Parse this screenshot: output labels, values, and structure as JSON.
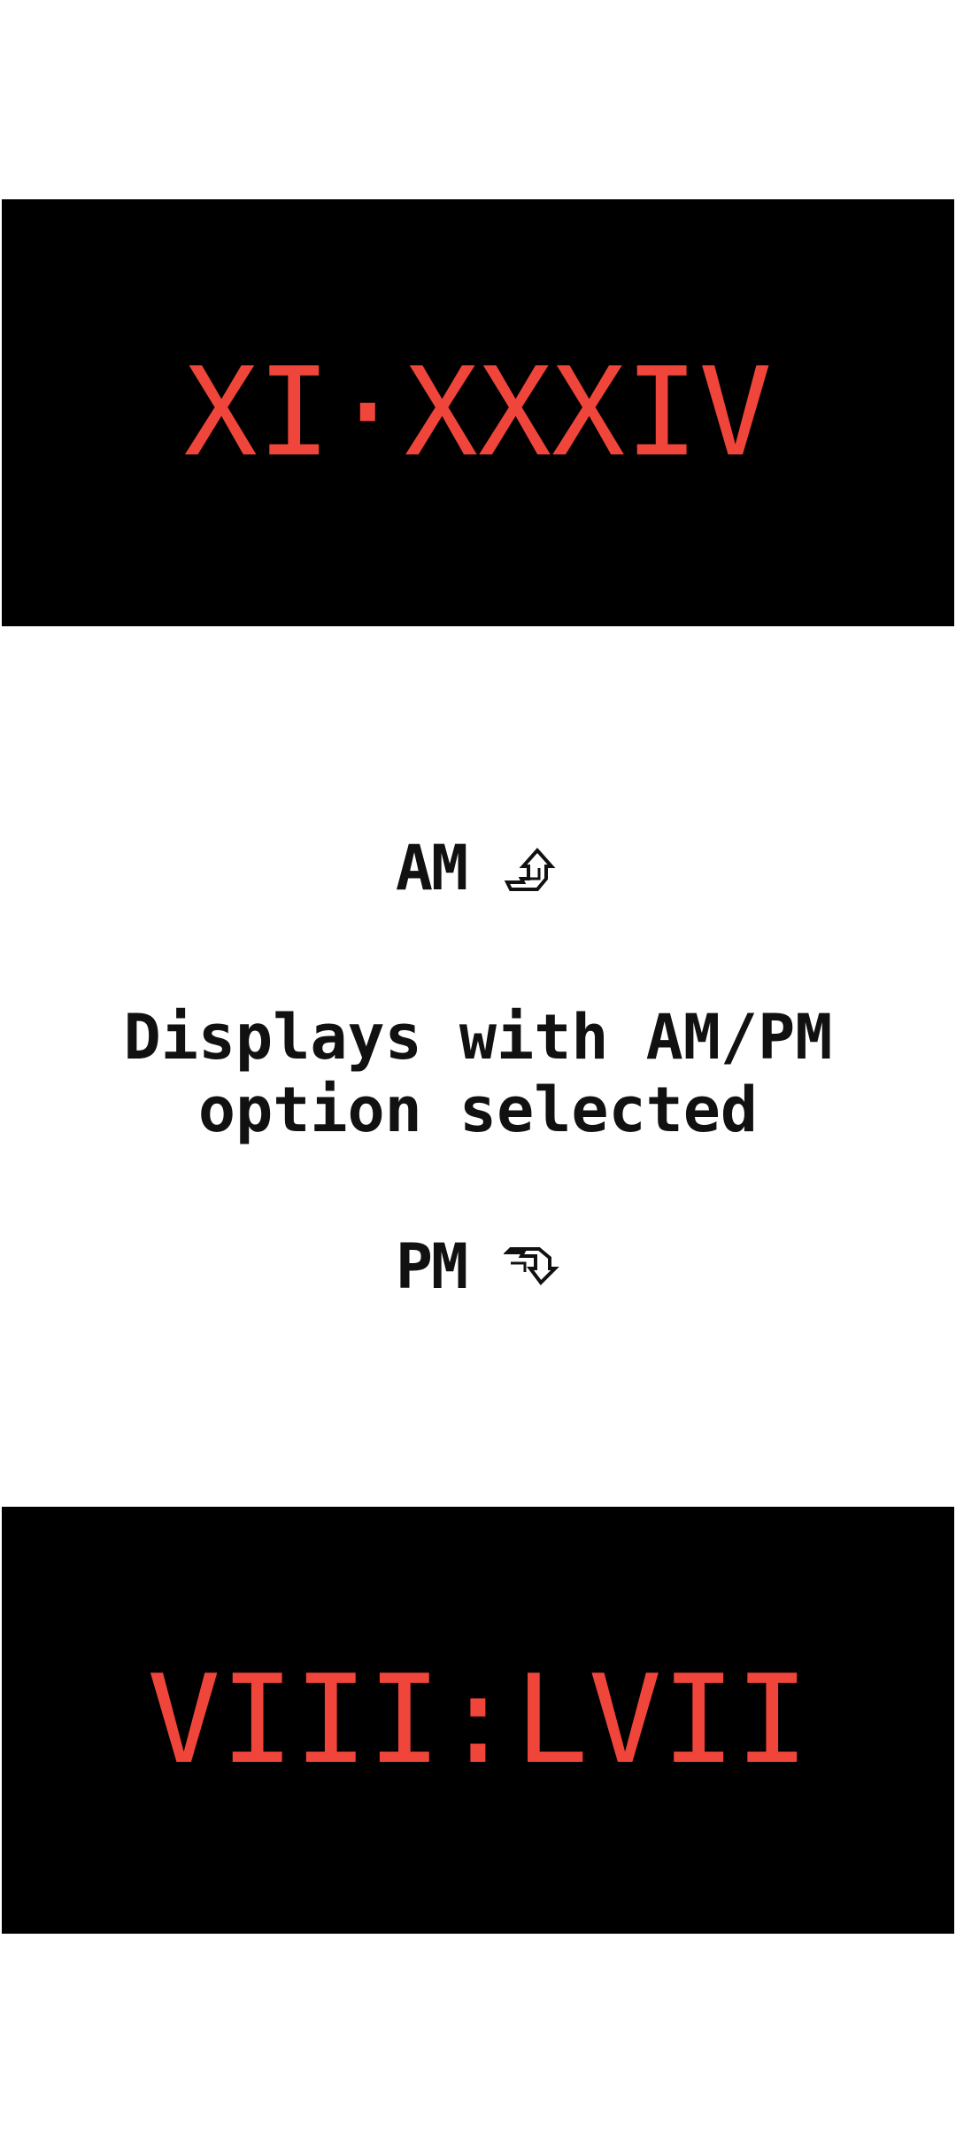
{
  "clocks": {
    "am_time": "XI·XXXIV",
    "pm_time": "VIII:LVII"
  },
  "indicators": {
    "am_label": "AM",
    "am_icon": "sunrise-arrow-icon",
    "pm_label": "PM",
    "pm_icon": "sunset-arrow-icon"
  },
  "caption": {
    "line1": "Displays with AM/PM",
    "line2": "option selected"
  },
  "colors": {
    "background": "#ffffff",
    "panel": "#000000",
    "digits": "#f0453a",
    "text": "#111111"
  }
}
